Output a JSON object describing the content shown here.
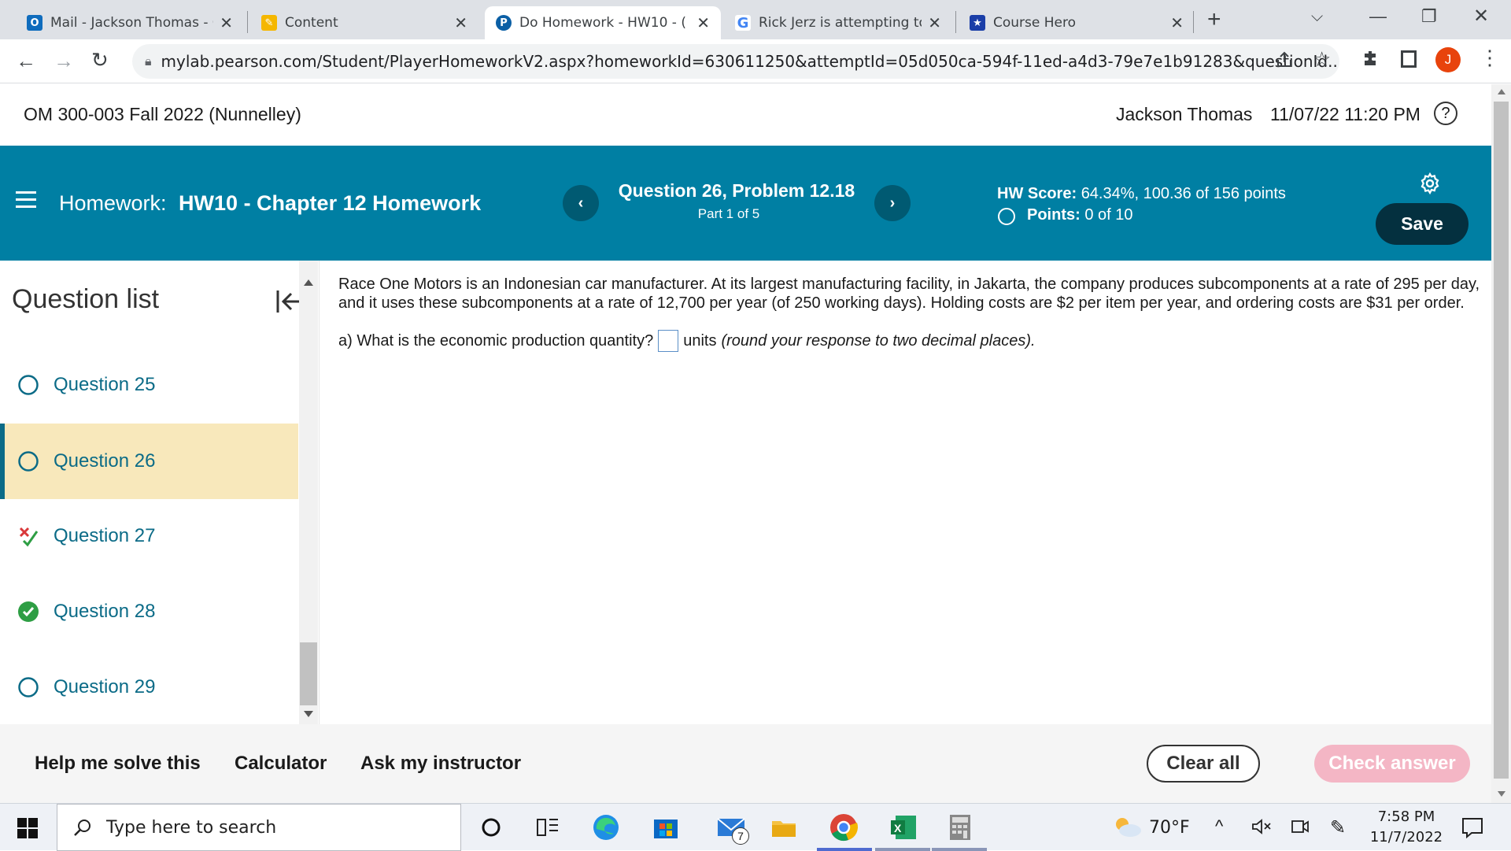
{
  "browser": {
    "tabs": [
      {
        "title": "Mail - Jackson Thomas - C",
        "favicon": "outlook-icon",
        "active": false
      },
      {
        "title": "Content",
        "favicon": "pencil-icon",
        "active": false
      },
      {
        "title": "Do Homework - HW10 - (",
        "favicon": "pearson-icon",
        "active": true
      },
      {
        "title": "Rick Jerz is attempting to",
        "favicon": "google-icon",
        "active": false
      },
      {
        "title": "Course Hero",
        "favicon": "course-hero-icon",
        "active": false
      }
    ],
    "url": "mylab.pearson.com/Student/PlayerHomeworkV2.aspx?homeworkId=630611250&attemptId=05d050ca-594f-11ed-a4d3-79e7e1b91283&questionId...",
    "profile_initial": "J"
  },
  "course": {
    "title": "OM 300-003 Fall 2022 (Nunnelley)",
    "user": "Jackson Thomas",
    "datetime": "11/07/22 11:20 PM"
  },
  "header": {
    "homework_prefix": "Homework:",
    "homework_name": "HW10 - Chapter 12 Homework",
    "question_title": "Question 26, Problem 12.18",
    "part": "Part 1 of 5",
    "score_label": "HW Score:",
    "score_value": "64.34%, 100.36 of 156 points",
    "points_label": "Points:",
    "points_value": "0 of 10",
    "save_label": "Save"
  },
  "sidebar": {
    "title": "Question list",
    "items": [
      {
        "label": "Question 25",
        "status": "unanswered"
      },
      {
        "label": "Question 26",
        "status": "current"
      },
      {
        "label": "Question 27",
        "status": "partial"
      },
      {
        "label": "Question 28",
        "status": "correct"
      },
      {
        "label": "Question 29",
        "status": "unanswered"
      }
    ]
  },
  "problem": {
    "line1": "Race One Motors is an Indonesian car manufacturer. At its largest manufacturing facility, in Jakarta, the company produces subcomponents at a rate of 295 per day,",
    "line2": "and it uses these subcomponents at a rate of 12,700 per year (of 250 working days). Holding costs are $2 per item per year, and ordering costs are $31 per order.",
    "question_prefix": "a) What is the economic production quantity?",
    "answer_value": "",
    "units": "units",
    "instruction": "(round your response to two decimal places)."
  },
  "footer": {
    "help": "Help me solve this",
    "calculator": "Calculator",
    "ask": "Ask my instructor",
    "clear": "Clear all",
    "check": "Check answer"
  },
  "taskbar": {
    "search_placeholder": "Type here to search",
    "mail_badge": "7",
    "weather": "70°F",
    "time": "7:58 PM",
    "date": "11/7/2022"
  },
  "colors": {
    "header_blue": "#007fa3",
    "link_teal": "#0b6b87",
    "current_highlight": "#f8e8bb",
    "check_button": "#f4b6c5",
    "correct_green": "#2e9e44"
  }
}
